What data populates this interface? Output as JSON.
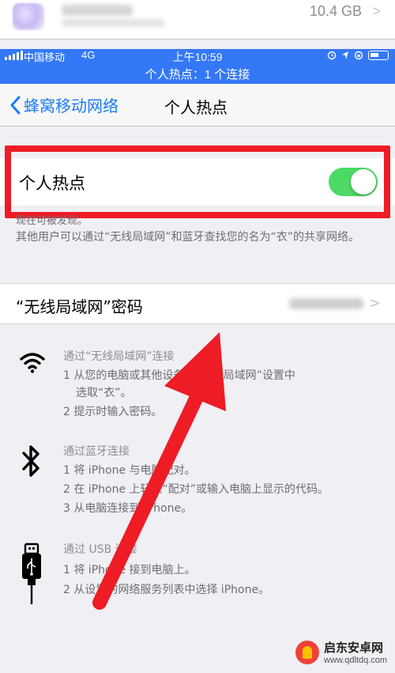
{
  "storage": {
    "size": "10.4 GB",
    "chevron": ">"
  },
  "status_bar": {
    "carrier": "中国移动",
    "network": "4G",
    "time": "上午10:59",
    "hotspot_banner": "个人热点：1 个连接"
  },
  "nav": {
    "back_label": "蜂窝移动网络",
    "title": "个人热点"
  },
  "hotspot": {
    "toggle_label": "个人热点",
    "toggle_on": true,
    "discoverable": "现在可被发现。",
    "description": "其他用户可以通过“无线局域网”和蓝牙查找您的名为“衣”的共享网络。"
  },
  "password": {
    "label": "“无线局域网”密码",
    "chevron": ">"
  },
  "instructions": {
    "wifi": {
      "title": "通过“无线局域网”连接",
      "steps": [
        "1 从您的电脑或其他设备的“无线局域网”设置中",
        "选取“衣”。",
        "2 提示时输入密码。"
      ]
    },
    "bluetooth": {
      "title": "通过蓝牙连接",
      "steps": [
        "1 将 iPhone 与电脑配对。",
        "2 在 iPhone 上轻点“配对”或输入电脑上显示的代码。",
        "3 从电脑连接到 iPhone。"
      ]
    },
    "usb": {
      "title": "通过 USB 连接",
      "steps": [
        "1 将 iPhone 接到电脑上。",
        "2 从设置的网络服务列表中选择 iPhone。"
      ]
    }
  },
  "watermark": {
    "name": "启东安卓网",
    "url": "www.qdltdq.com"
  },
  "colors": {
    "accent": "#1a7cf7",
    "status_bar": "#3478f6",
    "toggle_on": "#4cd964",
    "highlight": "#ee1c25",
    "arrow": "#ee1c25"
  }
}
